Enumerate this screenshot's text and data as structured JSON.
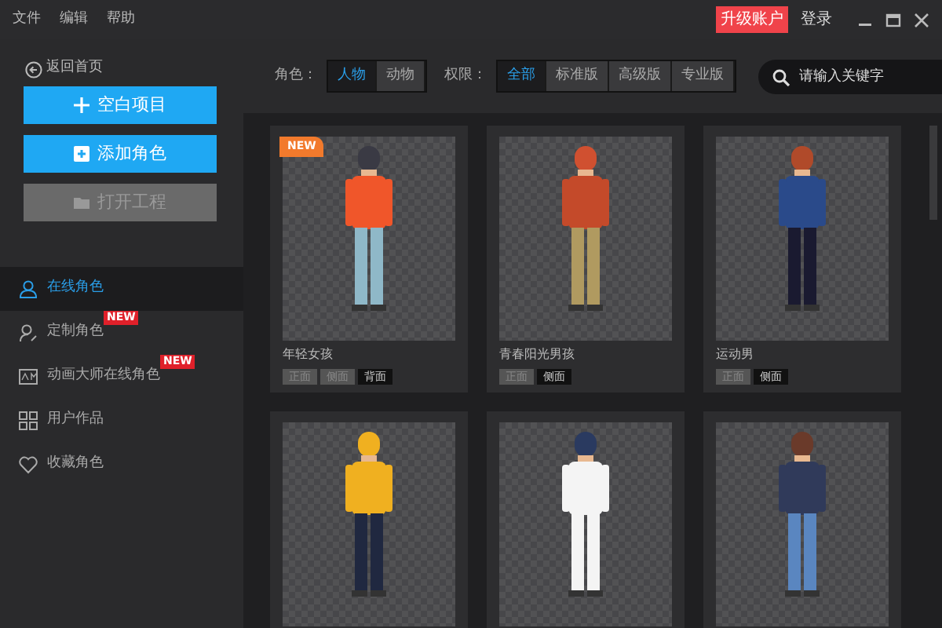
{
  "menu": [
    "文件",
    "编辑",
    "帮助"
  ],
  "account": {
    "upgrade": "升级账户",
    "login": "登录"
  },
  "sidebar": {
    "back": "返回首页",
    "buttons": [
      {
        "label": "空白项目",
        "kind": "plus",
        "disabled": false
      },
      {
        "label": "添加角色",
        "kind": "add",
        "disabled": false
      },
      {
        "label": "打开工程",
        "kind": "folder",
        "disabled": true
      }
    ],
    "items": [
      {
        "label": "在线角色",
        "kind": "person",
        "selected": true
      },
      {
        "label": "定制角色",
        "kind": "person-edit",
        "selected": false,
        "badge": "NEW"
      },
      {
        "label": "动画大师在线角色",
        "kind": "am",
        "selected": false,
        "badge": "NEW"
      },
      {
        "label": "用户作品",
        "kind": "grid",
        "selected": false
      },
      {
        "label": "收藏角色",
        "kind": "heart",
        "selected": false
      }
    ]
  },
  "filters": [
    {
      "label": "角色：",
      "options": [
        {
          "label": "人物",
          "selected": true
        },
        {
          "label": "动物",
          "selected": false
        }
      ]
    },
    {
      "label": "权限：",
      "options": [
        {
          "label": "全部",
          "selected": true
        },
        {
          "label": "标准版",
          "selected": false
        },
        {
          "label": "高级版",
          "selected": false
        },
        {
          "label": "专业版",
          "selected": false
        }
      ]
    }
  ],
  "search": {
    "placeholder": "请输入关键字"
  },
  "cards": [
    {
      "kind": "character",
      "badge": "NEW",
      "name": "年轻女孩",
      "views": [
        {
          "label": "正面",
          "selected": false
        },
        {
          "label": "侧面",
          "selected": false
        },
        {
          "label": "背面",
          "selected": true
        }
      ]
    },
    {
      "kind": "character",
      "name": "青春阳光男孩",
      "views": [
        {
          "label": "正面",
          "selected": false
        },
        {
          "label": "侧面",
          "selected": true
        }
      ]
    },
    {
      "kind": "character",
      "name": "运动男",
      "views": [
        {
          "label": "正面",
          "selected": false
        },
        {
          "label": "侧面",
          "selected": true
        }
      ]
    },
    {
      "kind": "character"
    },
    {
      "kind": "character"
    },
    {
      "kind": "character"
    }
  ]
}
